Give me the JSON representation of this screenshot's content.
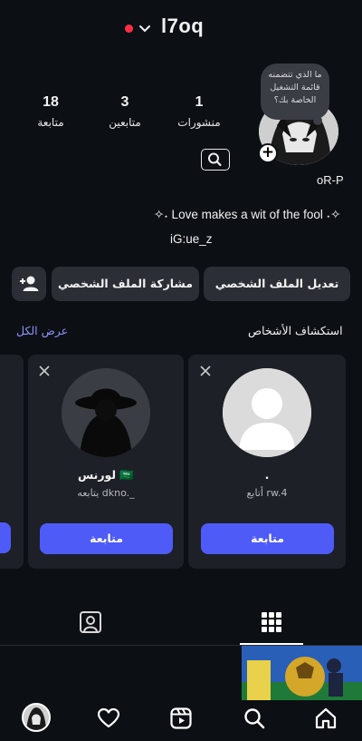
{
  "header": {
    "username": "l7oq"
  },
  "profile": {
    "note": "ما الذي تتضمنه قائمة التشغيل الخاصة بك؟",
    "display_name": "oR-P",
    "bio_line1": "✧˖ Love makes a wit of the fool ˖✧",
    "bio_line2": "iG:ue_z"
  },
  "stats": {
    "posts": {
      "value": "1",
      "label": "منشورات"
    },
    "followers": {
      "value": "3",
      "label": "متابعين"
    },
    "following": {
      "value": "18",
      "label": "متابعة"
    }
  },
  "actions": {
    "edit_profile": "تعديل الملف الشخصي",
    "share_profile": "مشاركة الملف الشخصي"
  },
  "discover": {
    "title": "استكشاف الأشخاص",
    "see_all": "عرض الكل",
    "cards": [
      {
        "name": ".",
        "subtitle": "أتابع rw.4",
        "follow_label": "متابعة"
      },
      {
        "name": "لورنس 🇸🇦",
        "subtitle": "يتابعه dkno._",
        "follow_label": "متابعة"
      }
    ]
  },
  "colors": {
    "background": "#0c0f14",
    "accent": "#4f5bf7",
    "link": "#8e93ff",
    "live_dot": "#ff2d46"
  },
  "icons": {
    "header": [
      "red-dot",
      "chevron-down-icon"
    ],
    "tabs": [
      "grid-icon",
      "tagged-person-icon"
    ],
    "nav": [
      "home-icon",
      "search-icon",
      "reels-icon",
      "heart-icon",
      "profile-avatar"
    ]
  }
}
